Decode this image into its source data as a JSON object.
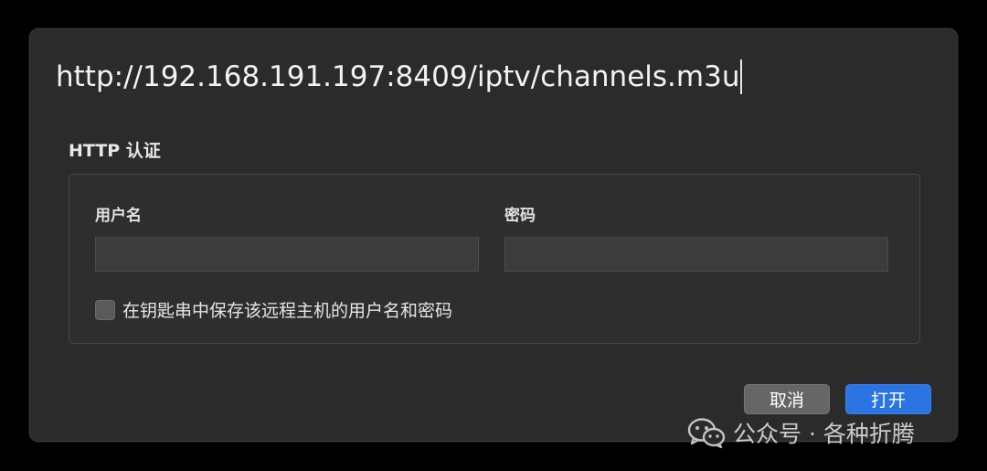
{
  "dialog": {
    "url_value": "http://192.168.191.197:8409/iptv/channels.m3u",
    "section_title": "HTTP 认证",
    "username_label": "用户名",
    "password_label": "密码",
    "username_value": "",
    "password_value": "",
    "keychain_checkbox_label": "在钥匙串中保存该远程主机的用户名和密码",
    "keychain_checked": false,
    "cancel_label": "取消",
    "open_label": "打开"
  },
  "watermark": {
    "text": "公众号 · 各种折腾",
    "icon": "wechat-icon"
  },
  "colors": {
    "dialog_bg": "#2b2b2b",
    "primary_button": "#2b74e3",
    "secondary_button": "#666666"
  }
}
